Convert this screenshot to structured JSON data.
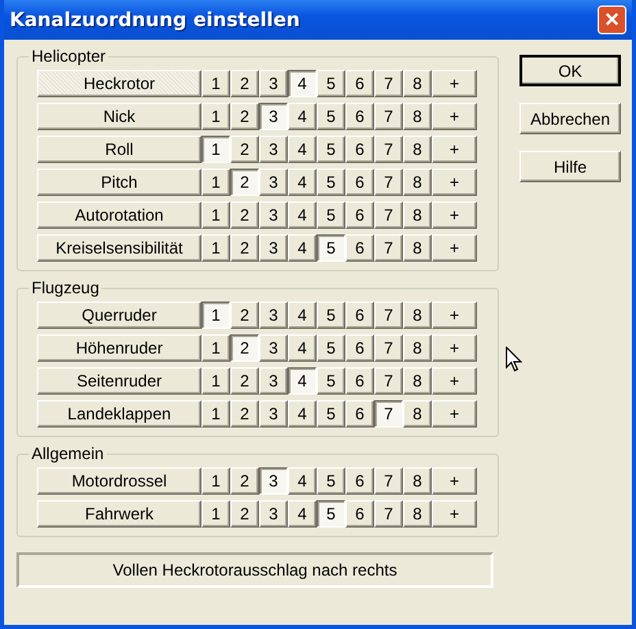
{
  "window": {
    "title": "Kanalzuordnung einstellen",
    "close": "×"
  },
  "groups": [
    {
      "title": "Helicopter",
      "rows": [
        {
          "label": "Heckrotor",
          "active": true,
          "channels": [
            {
              "label": "1",
              "selected": false
            },
            {
              "label": "2",
              "selected": false
            },
            {
              "label": "3",
              "selected": false
            },
            {
              "label": "4",
              "selected": true
            },
            {
              "label": "5",
              "selected": false
            },
            {
              "label": "6",
              "selected": false
            },
            {
              "label": "7",
              "selected": false
            },
            {
              "label": "8",
              "selected": false
            }
          ],
          "add": "+"
        },
        {
          "label": "Nick",
          "active": false,
          "channels": [
            {
              "label": "1",
              "selected": false
            },
            {
              "label": "2",
              "selected": false
            },
            {
              "label": "3",
              "selected": true
            },
            {
              "label": "4",
              "selected": false
            },
            {
              "label": "5",
              "selected": false
            },
            {
              "label": "6",
              "selected": false
            },
            {
              "label": "7",
              "selected": false
            },
            {
              "label": "8",
              "selected": false
            }
          ],
          "add": "+"
        },
        {
          "label": "Roll",
          "active": false,
          "channels": [
            {
              "label": "1",
              "selected": true
            },
            {
              "label": "2",
              "selected": false
            },
            {
              "label": "3",
              "selected": false
            },
            {
              "label": "4",
              "selected": false
            },
            {
              "label": "5",
              "selected": false
            },
            {
              "label": "6",
              "selected": false
            },
            {
              "label": "7",
              "selected": false
            },
            {
              "label": "8",
              "selected": false
            }
          ],
          "add": "+"
        },
        {
          "label": "Pitch",
          "active": false,
          "channels": [
            {
              "label": "1",
              "selected": false
            },
            {
              "label": "2",
              "selected": true
            },
            {
              "label": "3",
              "selected": false
            },
            {
              "label": "4",
              "selected": false
            },
            {
              "label": "5",
              "selected": false
            },
            {
              "label": "6",
              "selected": false
            },
            {
              "label": "7",
              "selected": false
            },
            {
              "label": "8",
              "selected": false
            }
          ],
          "add": "+"
        },
        {
          "label": "Autorotation",
          "active": false,
          "channels": [
            {
              "label": "1",
              "selected": false
            },
            {
              "label": "2",
              "selected": false
            },
            {
              "label": "3",
              "selected": false
            },
            {
              "label": "4",
              "selected": false
            },
            {
              "label": "5",
              "selected": false
            },
            {
              "label": "6",
              "selected": false
            },
            {
              "label": "7",
              "selected": false
            },
            {
              "label": "8",
              "selected": false
            }
          ],
          "add": "+"
        },
        {
          "label": "Kreiselsensibilität",
          "active": false,
          "channels": [
            {
              "label": "1",
              "selected": false
            },
            {
              "label": "2",
              "selected": false
            },
            {
              "label": "3",
              "selected": false
            },
            {
              "label": "4",
              "selected": false
            },
            {
              "label": "5",
              "selected": true
            },
            {
              "label": "6",
              "selected": false
            },
            {
              "label": "7",
              "selected": false
            },
            {
              "label": "8",
              "selected": false
            }
          ],
          "add": "+"
        }
      ]
    },
    {
      "title": "Flugzeug",
      "rows": [
        {
          "label": "Querruder",
          "active": false,
          "channels": [
            {
              "label": "1",
              "selected": true
            },
            {
              "label": "2",
              "selected": false
            },
            {
              "label": "3",
              "selected": false
            },
            {
              "label": "4",
              "selected": false
            },
            {
              "label": "5",
              "selected": false
            },
            {
              "label": "6",
              "selected": false
            },
            {
              "label": "7",
              "selected": false
            },
            {
              "label": "8",
              "selected": false
            }
          ],
          "add": "+"
        },
        {
          "label": "Höhenruder",
          "active": false,
          "channels": [
            {
              "label": "1",
              "selected": false
            },
            {
              "label": "2",
              "selected": true
            },
            {
              "label": "3",
              "selected": false
            },
            {
              "label": "4",
              "selected": false
            },
            {
              "label": "5",
              "selected": false
            },
            {
              "label": "6",
              "selected": false
            },
            {
              "label": "7",
              "selected": false
            },
            {
              "label": "8",
              "selected": false
            }
          ],
          "add": "+"
        },
        {
          "label": "Seitenruder",
          "active": false,
          "channels": [
            {
              "label": "1",
              "selected": false
            },
            {
              "label": "2",
              "selected": false
            },
            {
              "label": "3",
              "selected": false
            },
            {
              "label": "4",
              "selected": true
            },
            {
              "label": "5",
              "selected": false
            },
            {
              "label": "6",
              "selected": false
            },
            {
              "label": "7",
              "selected": false
            },
            {
              "label": "8",
              "selected": false
            }
          ],
          "add": "+"
        },
        {
          "label": "Landeklappen",
          "active": false,
          "channels": [
            {
              "label": "1",
              "selected": false
            },
            {
              "label": "2",
              "selected": false
            },
            {
              "label": "3",
              "selected": false
            },
            {
              "label": "4",
              "selected": false
            },
            {
              "label": "5",
              "selected": false
            },
            {
              "label": "6",
              "selected": false
            },
            {
              "label": "7",
              "selected": true
            },
            {
              "label": "8",
              "selected": false
            }
          ],
          "add": "+"
        }
      ]
    },
    {
      "title": "Allgemein",
      "rows": [
        {
          "label": "Motordrossel",
          "active": false,
          "channels": [
            {
              "label": "1",
              "selected": false
            },
            {
              "label": "2",
              "selected": false
            },
            {
              "label": "3",
              "selected": true
            },
            {
              "label": "4",
              "selected": false
            },
            {
              "label": "5",
              "selected": false
            },
            {
              "label": "6",
              "selected": false
            },
            {
              "label": "7",
              "selected": false
            },
            {
              "label": "8",
              "selected": false
            }
          ],
          "add": "+"
        },
        {
          "label": "Fahrwerk",
          "active": false,
          "channels": [
            {
              "label": "1",
              "selected": false
            },
            {
              "label": "2",
              "selected": false
            },
            {
              "label": "3",
              "selected": false
            },
            {
              "label": "4",
              "selected": false
            },
            {
              "label": "5",
              "selected": true
            },
            {
              "label": "6",
              "selected": false
            },
            {
              "label": "7",
              "selected": false
            },
            {
              "label": "8",
              "selected": false
            }
          ],
          "add": "+"
        }
      ]
    }
  ],
  "status": "Vollen Heckrotorausschlag nach rechts",
  "buttons": [
    {
      "label": "OK",
      "default": true
    },
    {
      "label": "Abbrechen",
      "default": false
    },
    {
      "label": "Hilfe",
      "default": false
    }
  ]
}
